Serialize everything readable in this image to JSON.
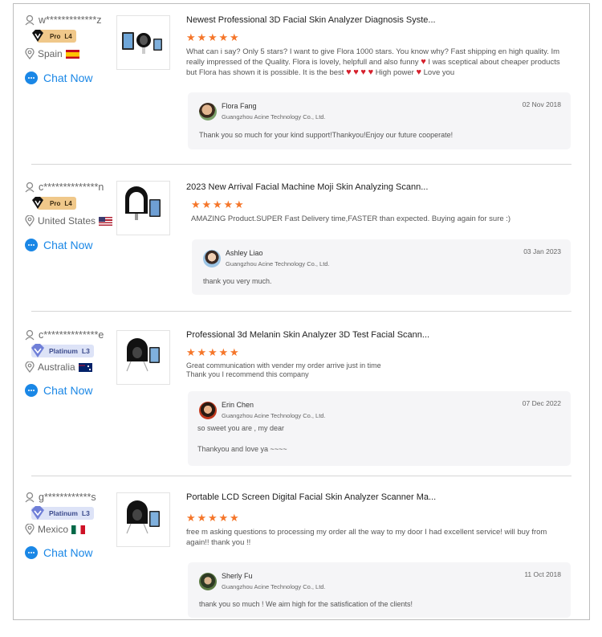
{
  "reviews": [
    {
      "username": "w*************z",
      "level_badge": "Pro",
      "level_tier": "L4",
      "country": "Spain",
      "chat_label": "Chat Now",
      "product_title": "Newest Professional 3D Facial Skin Analyzer Diagnosis Syste...",
      "rating": 5,
      "text_parts": [
        "What can i say? Only 5 stars? I want to give Flora 1000 stars. You know why? Fast shipping en high quality. Im really impressed of the Quality. Flora is lovely, helpfull and also funny ",
        " I was sceptical about cheaper products but Flora has shown it is possible. It is the best ",
        " High power ",
        " Love you"
      ],
      "reply": {
        "name": "Flora Fang",
        "company": "Guangzhou Acine Technology Co., Ltd.",
        "date": "02 Nov 2018",
        "message": "Thank you so much for your kind support!Thankyou!Enjoy our future cooperate!",
        "message2": ""
      }
    },
    {
      "username": "c**************n",
      "level_badge": "Pro",
      "level_tier": "L4",
      "country": "United States",
      "chat_label": "Chat Now",
      "product_title": "2023 New Arrival Facial Machine Moji Skin Analyzing Scann...",
      "rating": 5,
      "text": "AMAZING Product.SUPER Fast Delivery time,FASTER than expected. Buying again for sure :)",
      "reply": {
        "name": "Ashley Liao",
        "company": "Guangzhou Acine Technology Co., Ltd.",
        "date": "03 Jan 2023",
        "message": "thank you very much.",
        "message2": ""
      }
    },
    {
      "username": "c**************e",
      "level_badge": "Platinum",
      "level_tier": "L3",
      "country": "Australia",
      "chat_label": "Chat Now",
      "product_title": "Professional 3d Melanin Skin Analyzer 3D Test Facial Scann...",
      "rating": 5,
      "text": "Great communication with vender my order arrive just in time\nThank you I recommend this company",
      "reply": {
        "name": "Erin Chen",
        "company": "Guangzhou Acine Technology Co., Ltd.",
        "date": "07 Dec 2022",
        "message": "so sweet you are , my dear",
        "message2": "Thankyou and love ya ~~~~"
      }
    },
    {
      "username": "g************s",
      "level_badge": "Platinum",
      "level_tier": "L3",
      "country": "Mexico",
      "chat_label": "Chat Now",
      "product_title": "Portable LCD Screen Digital Facial Skin Analyzer Scanner Ma...",
      "rating": 5,
      "text": "free m asking questions to processing my order all the way to my door I had excellent service! will buy from again!! thank you !!",
      "reply": {
        "name": "Sherly Fu",
        "company": "Guangzhou Acine Technology Co., Ltd.",
        "date": "11 Oct 2018",
        "message": "thank you so much ! We aim high for the satisfication of the clients!",
        "message2": ""
      }
    }
  ],
  "colors": {
    "accent_blue": "#1a87e6",
    "star_orange": "#f5762a",
    "heart_red": "#d6202c",
    "pro_badge": "#f0c88a",
    "platinum_badge": "#dde3f7"
  }
}
